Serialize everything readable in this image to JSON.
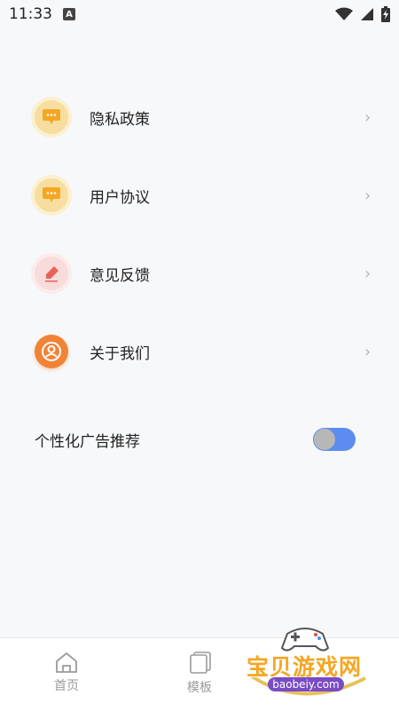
{
  "status_bar": {
    "time": "11:33",
    "badge": "A"
  },
  "menu": {
    "items": [
      {
        "label": "隐私政策",
        "icon": "chat-bubble-icon"
      },
      {
        "label": "用户协议",
        "icon": "chat-bubble-icon"
      },
      {
        "label": "意见反馈",
        "icon": "pen-icon"
      },
      {
        "label": "关于我们",
        "icon": "user-circle-icon"
      }
    ],
    "chevron": "›"
  },
  "settings": {
    "personalized_ads_label": "个性化广告推荐",
    "personalized_ads_enabled": true
  },
  "bottom_nav": {
    "items": [
      {
        "label": "首页",
        "icon": "home-icon"
      },
      {
        "label": "模板",
        "icon": "template-stack-icon"
      }
    ]
  },
  "watermark": {
    "text": "宝贝游戏网",
    "url": "baobeiy.com"
  },
  "colors": {
    "accent_blue": "#5b8df0",
    "icon_yellow": "#f7dea0",
    "icon_orange": "#f18336",
    "icon_pink": "#f7dcdb"
  }
}
